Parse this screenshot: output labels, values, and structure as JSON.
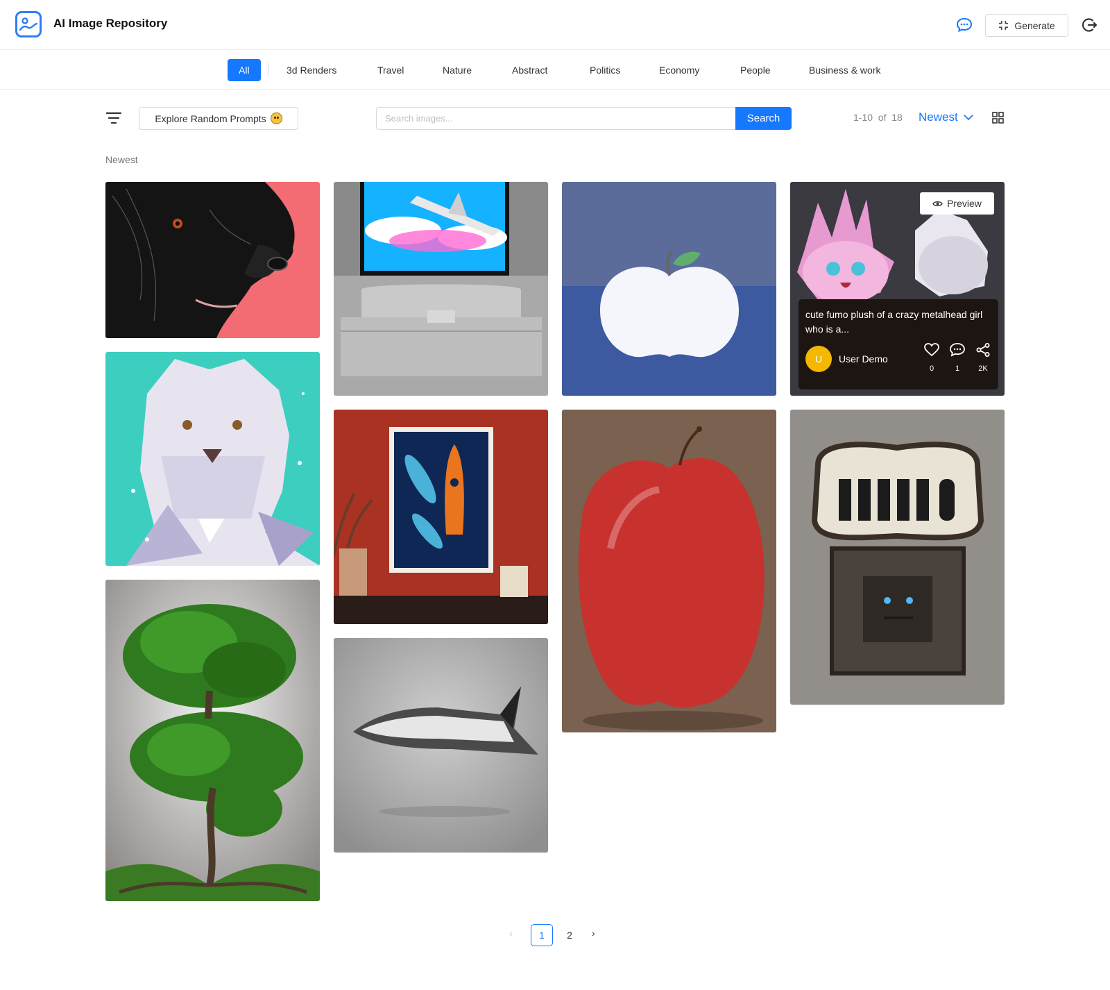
{
  "header": {
    "app_title": "AI Image Repository",
    "generate_label": "Generate",
    "icons": [
      "logo-image-icon",
      "chat-icon",
      "generate-icon",
      "logout-icon"
    ]
  },
  "categories": {
    "active": "All",
    "items": [
      "3d Renders",
      "Travel",
      "Nature",
      "Abstract",
      "Politics",
      "Economy",
      "People",
      "Business & work"
    ]
  },
  "toolbar": {
    "explore_label": "Explore Random Prompts",
    "search_placeholder": "Search images...",
    "search_label": "Search",
    "range_text": "1-10  of  18",
    "sort_label": "Newest"
  },
  "section_label": "Newest",
  "hover_card": {
    "preview_label": "Preview",
    "prompt": "cute fumo plush of a crazy metalhead girl who is a...",
    "user_initial": "U",
    "user_name": "User Demo",
    "likes": "0",
    "comments": "1",
    "shares": "2K"
  },
  "images": [
    "black-dog-portrait",
    "white-lion-lowpoly",
    "bonsai-tree",
    "bedroom-airplane-painting",
    "rocket-poster-wall",
    "space-shuttle",
    "white-apple-3d",
    "red-apple-painting",
    "fumo-plush-figures",
    "hello-gothic-sign"
  ],
  "pagination": {
    "prev": "‹",
    "page1": "1",
    "page2": "2",
    "next": "›"
  },
  "colors": {
    "accent": "#1677ff",
    "avatar": "#f5b800",
    "panel": "#1d1512"
  }
}
